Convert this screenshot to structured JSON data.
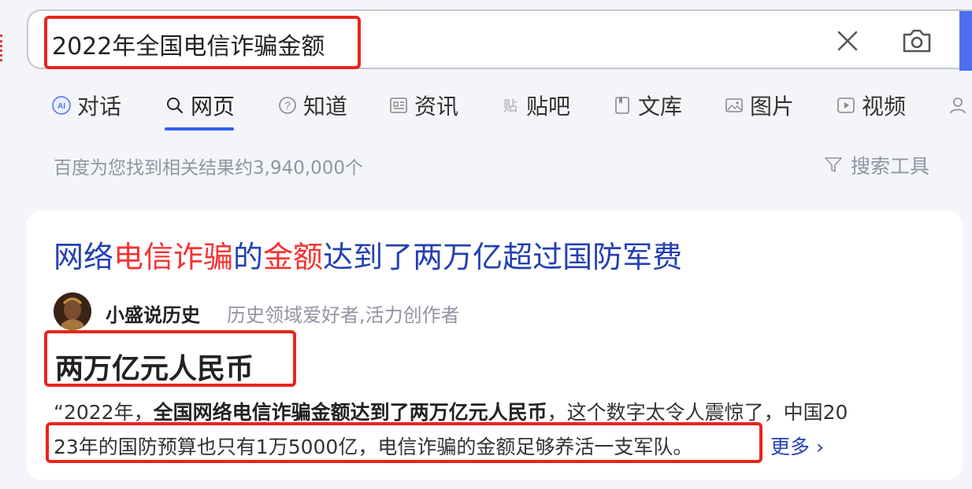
{
  "search": {
    "query": "2022年全国电信诈骗金额"
  },
  "tabs": [
    {
      "label": "对话",
      "icon": "ai-chat-icon"
    },
    {
      "label": "网页",
      "icon": "search-icon",
      "active": true
    },
    {
      "label": "知道",
      "icon": "question-icon"
    },
    {
      "label": "资讯",
      "icon": "news-icon"
    },
    {
      "label": "贴吧",
      "icon": "tieba-icon"
    },
    {
      "label": "文库",
      "icon": "document-icon"
    },
    {
      "label": "图片",
      "icon": "image-icon"
    },
    {
      "label": "视频",
      "icon": "video-icon"
    }
  ],
  "result_count": "百度为您找到相关结果约3,940,000个",
  "search_tools": "搜索工具",
  "result": {
    "title_parts": [
      "网络",
      "电信诈骗",
      "的",
      "金额",
      "达到了两万亿超过国防军费"
    ],
    "author": "小盛说历史",
    "author_desc": "历史领域爱好者,活力创作者",
    "answer": "两万亿元人民币",
    "snippet_line1_a": "“2022年，",
    "snippet_line1_b": "全国网络电信诈骗金额达到了两万亿元人民币",
    "snippet_line1_c": "，这个数字太令人震惊了，中国20",
    "snippet_line2": "23年的国防预算也只有1万5000亿，电信诈骗的金额足够养活一支军队。",
    "more": "更多"
  },
  "colors": {
    "accent": "#4e6ef2",
    "link": "#2440b3",
    "highlight": "#f73131",
    "annotation": "#e8251c"
  }
}
